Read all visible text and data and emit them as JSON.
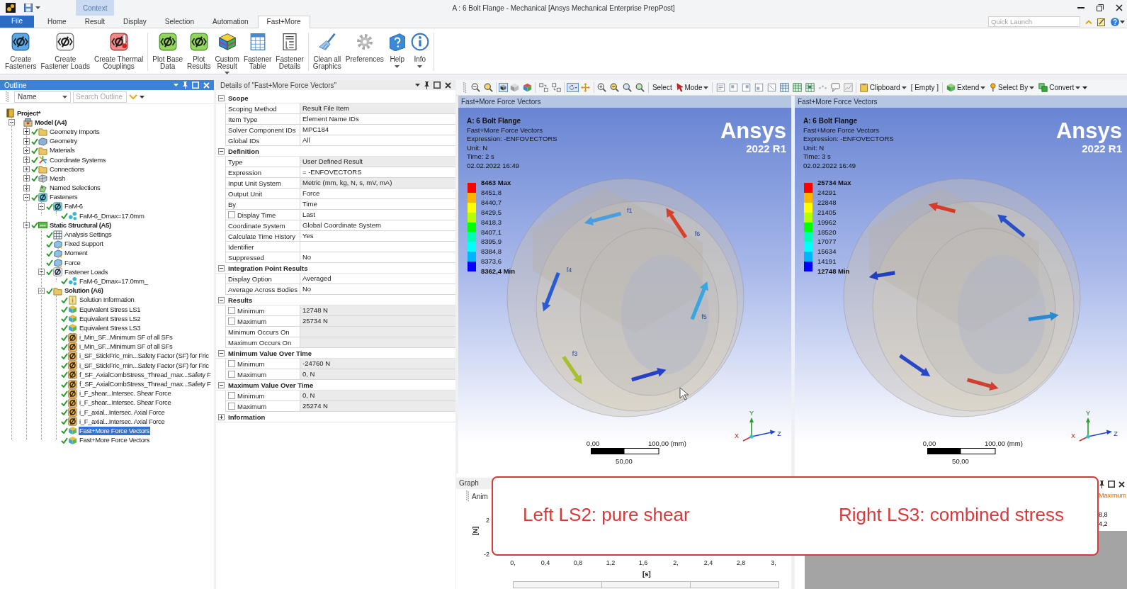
{
  "window": {
    "title": "A : 6 Bolt Flange - Mechanical [Ansys Mechanical Enterprise PrepPost]",
    "context_tab": "Context"
  },
  "tabs": [
    {
      "label": "File",
      "kind": "file",
      "selected": false
    },
    {
      "label": "Home",
      "kind": "tab",
      "selected": false
    },
    {
      "label": "Result",
      "kind": "tab",
      "selected": false
    },
    {
      "label": "Display",
      "kind": "tab",
      "selected": false
    },
    {
      "label": "Selection",
      "kind": "tab",
      "selected": false
    },
    {
      "label": "Automation",
      "kind": "tab",
      "selected": false
    },
    {
      "label": "Fast+More",
      "kind": "tab",
      "selected": true
    }
  ],
  "quick_launch": {
    "placeholder": "Quick Launch"
  },
  "ribbon": {
    "groups": [
      {
        "buttons": [
          {
            "label": "Create\nFasteners",
            "dropdown": false
          },
          {
            "label": "Create\nFastener Loads",
            "dropdown": false
          },
          {
            "label": "Create Thermal\nCouplings",
            "dropdown": false
          }
        ]
      },
      {
        "buttons": [
          {
            "label": "Plot Base\nData",
            "dropdown": false
          },
          {
            "label": "Plot\nResults",
            "dropdown": false
          },
          {
            "label": "Custom\nResult",
            "dropdown": true
          },
          {
            "label": "Fastener\nTable",
            "dropdown": false
          },
          {
            "label": "Fastener\nDetails",
            "dropdown": false
          }
        ]
      },
      {
        "buttons": [
          {
            "label": "Clean all\nGraphics",
            "dropdown": false
          },
          {
            "label": "Preferences",
            "dropdown": false
          },
          {
            "label": "Help",
            "dropdown": true
          },
          {
            "label": "Info",
            "dropdown": true
          }
        ]
      }
    ]
  },
  "outline": {
    "title": "Outline",
    "column": "Name",
    "search": {
      "placeholder": "Search Outline"
    },
    "tree": [
      {
        "label": "Project*",
        "kind": "project",
        "ok": false,
        "selected": false,
        "children": [
          {
            "label": "Model (A4)",
            "kind": "model",
            "ok": false,
            "selected": false,
            "expanded": true,
            "children": [
              {
                "label": "Geometry Imports",
                "kind": "folder",
                "ok": true,
                "selected": false,
                "expanded": false
              },
              {
                "label": "Geometry",
                "kind": "geometry",
                "ok": true,
                "selected": false,
                "expanded": false
              },
              {
                "label": "Materials",
                "kind": "folder",
                "ok": true,
                "selected": false,
                "expanded": false
              },
              {
                "label": "Coordinate Systems",
                "kind": "coordinates",
                "ok": true,
                "selected": false,
                "expanded": false
              },
              {
                "label": "Connections",
                "kind": "folder",
                "ok": true,
                "selected": false,
                "expanded": false
              },
              {
                "label": "Mesh",
                "kind": "mesh",
                "ok": true,
                "selected": false,
                "expanded": false
              },
              {
                "label": "Named Selections",
                "kind": "selection",
                "ok": false,
                "selected": false,
                "expanded": false
              },
              {
                "label": "Fasteners",
                "kind": "fastener",
                "ok": true,
                "selected": false,
                "expanded": true,
                "children": [
                  {
                    "label": "FaM-6",
                    "kind": "fastener",
                    "ok": true,
                    "selected": false,
                    "expanded": true,
                    "children": [
                      {
                        "label": "FaM-6_Dmax=17.0mm",
                        "kind": "points",
                        "ok": true,
                        "selected": false
                      }
                    ]
                  }
                ]
              },
              {
                "label": "Static Structural (A5)",
                "kind": "analysis",
                "ok": true,
                "selected": false,
                "expanded": true,
                "children": [
                  {
                    "label": "Analysis Settings",
                    "kind": "settings",
                    "ok": true,
                    "selected": false
                  },
                  {
                    "label": "Fixed Support",
                    "kind": "load",
                    "ok": true,
                    "selected": false
                  },
                  {
                    "label": "Moment",
                    "kind": "load",
                    "ok": true,
                    "selected": false
                  },
                  {
                    "label": "Force",
                    "kind": "load",
                    "ok": true,
                    "selected": false
                  },
                  {
                    "label": "Fastener Loads",
                    "kind": "fastener-load",
                    "ok": true,
                    "selected": false,
                    "expanded": true,
                    "children": [
                      {
                        "label": "FaM-6_Dmax=17.0mm_",
                        "kind": "points",
                        "ok": true,
                        "selected": false
                      }
                    ]
                  },
                  {
                    "label": "Solution (A6)",
                    "kind": "solution",
                    "ok": true,
                    "selected": false,
                    "expanded": true,
                    "children": [
                      {
                        "label": "Solution Information",
                        "kind": "info",
                        "ok": true,
                        "selected": false
                      },
                      {
                        "label": "Equivalent Stress LS1",
                        "kind": "result",
                        "ok": true,
                        "selected": false
                      },
                      {
                        "label": "Equivalent Stress LS2",
                        "kind": "result",
                        "ok": true,
                        "selected": false
                      },
                      {
                        "label": "Equivalent Stress LS3",
                        "kind": "result",
                        "ok": true,
                        "selected": false
                      },
                      {
                        "label": "i_Min_SF...Minimum SF of all SFs",
                        "kind": "sf-result",
                        "ok": true,
                        "selected": false
                      },
                      {
                        "label": "i_Min_SF...Minimum SF of all SFs",
                        "kind": "sf-result",
                        "ok": true,
                        "selected": false
                      },
                      {
                        "label": "i_SF_StickFric_min...Safety Factor (SF) for Fric",
                        "kind": "sf-result",
                        "ok": true,
                        "selected": false
                      },
                      {
                        "label": "i_SF_StickFric_min...Safety Factor (SF) for Fric",
                        "kind": "sf-result",
                        "ok": true,
                        "selected": false
                      },
                      {
                        "label": "f_SF_AxialCombStress_Thread_max...Safety F",
                        "kind": "sf-result",
                        "ok": true,
                        "selected": false
                      },
                      {
                        "label": "f_SF_AxialCombStress_Thread_max...Safety F",
                        "kind": "sf-result",
                        "ok": true,
                        "selected": false
                      },
                      {
                        "label": "i_F_shear...Intersec. Shear Force",
                        "kind": "sf-result",
                        "ok": true,
                        "selected": false
                      },
                      {
                        "label": "i_F_shear...Intersec. Shear Force",
                        "kind": "sf-result",
                        "ok": true,
                        "selected": false
                      },
                      {
                        "label": "i_F_axial...Intersec. Axial Force",
                        "kind": "sf-result",
                        "ok": true,
                        "selected": false
                      },
                      {
                        "label": "i_F_axial...Intersec. Axial Force",
                        "kind": "sf-result",
                        "ok": true,
                        "selected": false
                      },
                      {
                        "label": "Fast+More Force Vectors",
                        "kind": "user-result",
                        "ok": true,
                        "selected": true
                      },
                      {
                        "label": "Fast+More Force Vectors",
                        "kind": "user-result",
                        "ok": true,
                        "selected": false
                      }
                    ]
                  }
                ]
              }
            ]
          }
        ]
      }
    ]
  },
  "details": {
    "title": "Details of \"Fast+More Force Vectors\"",
    "groups": [
      {
        "title": "Scope",
        "expanded": true,
        "rows": [
          {
            "label": "Scoping Method",
            "value": "Result File Item",
            "kind": "plain",
            "readonly": true
          },
          {
            "label": "Item Type",
            "value": "Element Name IDs",
            "kind": "plain",
            "readonly": false
          },
          {
            "label": "Solver Component IDs",
            "value": "MPC184",
            "kind": "plain",
            "readonly": false
          },
          {
            "label": "Global IDs",
            "value": "All",
            "kind": "plain",
            "readonly": false
          }
        ]
      },
      {
        "title": "Definition",
        "expanded": true,
        "rows": [
          {
            "label": "Type",
            "value": "User Defined Result",
            "kind": "plain",
            "readonly": true
          },
          {
            "label": "Expression",
            "value": "= -ENFOVECTORS",
            "kind": "plain",
            "readonly": false
          },
          {
            "label": "Input Unit System",
            "value": "Metric (mm, kg, N, s, mV, mA)",
            "kind": "plain",
            "readonly": true
          },
          {
            "label": "Output Unit",
            "value": "Force",
            "kind": "plain",
            "readonly": false
          },
          {
            "label": "By",
            "value": "Time",
            "kind": "plain",
            "readonly": false
          },
          {
            "label": "Display Time",
            "value": "Last",
            "kind": "check",
            "checked": false,
            "readonly": false
          },
          {
            "label": "Coordinate System",
            "value": "Global Coordinate System",
            "kind": "plain",
            "readonly": false
          },
          {
            "label": "Calculate Time History",
            "value": "Yes",
            "kind": "plain",
            "readonly": false
          },
          {
            "label": "Identifier",
            "kind": "plain",
            "readonly": false
          },
          {
            "label": "Suppressed",
            "value": "No",
            "kind": "plain",
            "readonly": false
          }
        ]
      },
      {
        "title": "Integration Point Results",
        "expanded": true,
        "rows": [
          {
            "label": "Display Option",
            "value": "Averaged",
            "kind": "plain",
            "readonly": false
          },
          {
            "label": "Average Across Bodies",
            "value": "No",
            "kind": "plain",
            "readonly": false
          }
        ]
      },
      {
        "title": "Results",
        "expanded": true,
        "rows": [
          {
            "label": "Minimum",
            "value": "12748 N",
            "kind": "check",
            "checked": false,
            "readonly": true
          },
          {
            "label": "Maximum",
            "value": "25734 N",
            "kind": "check",
            "checked": false,
            "readonly": true
          },
          {
            "label": "Minimum Occurs On",
            "kind": "plain",
            "readonly": true
          },
          {
            "label": "Maximum Occurs On",
            "kind": "plain",
            "readonly": true
          }
        ]
      },
      {
        "title": "Minimum Value Over Time",
        "expanded": true,
        "rows": [
          {
            "label": "Minimum",
            "value": "-24760 N",
            "kind": "check",
            "checked": false,
            "readonly": true
          },
          {
            "label": "Maximum",
            "value": "0, N",
            "kind": "check",
            "checked": false,
            "readonly": true
          }
        ]
      },
      {
        "title": "Maximum Value Over Time",
        "expanded": true,
        "rows": [
          {
            "label": "Minimum",
            "value": "0, N",
            "kind": "check",
            "checked": false,
            "readonly": true
          },
          {
            "label": "Maximum",
            "value": "25274 N",
            "kind": "check",
            "checked": false,
            "readonly": true
          }
        ]
      },
      {
        "title": "Information",
        "expanded": false
      }
    ]
  },
  "view_toolbar": {
    "tools": [
      {
        "selected": false
      },
      {
        "selected": false
      },
      {
        "selected": true
      },
      {
        "selected": false
      },
      {
        "selected": false
      },
      {
        "selected": false
      },
      {
        "selected": false
      },
      {
        "selected": true
      },
      {
        "selected": false
      },
      {
        "selected": false
      },
      {
        "selected": false
      },
      {
        "selected": false
      },
      {
        "selected": false
      },
      {
        "selected": false
      },
      {
        "selected": false
      },
      {
        "selected": false
      },
      {
        "selected": false
      },
      {
        "selected": false
      },
      {
        "selected": false
      },
      {
        "selected": false
      },
      {
        "selected": false
      },
      {
        "selected": false
      },
      {
        "selected": false
      },
      {
        "selected": false
      }
    ],
    "buttons": [
      {
        "label": "Select",
        "dropdown": false
      },
      {
        "label": "Mode",
        "dropdown": true
      },
      {
        "label": "Clipboard",
        "dropdown": true
      },
      {
        "label": "[ Empty ]",
        "dropdown": false
      },
      {
        "label": "Extend",
        "dropdown": true
      },
      {
        "label": "Select By",
        "dropdown": true
      },
      {
        "label": "Convert",
        "dropdown": true
      }
    ]
  },
  "viewports": [
    {
      "header": "Fast+More Force Vectors",
      "info": {
        "title": "A: 6 Bolt Flange",
        "lines": [
          "Fast+More Force Vectors",
          "Expression: -ENFOVECTORS",
          "Unit: N",
          "Time: 2 s",
          "02.02.2022 16:49"
        ]
      },
      "logo": {
        "name": "Ansys",
        "version": "2022 R1"
      },
      "legend": {
        "labels": [
          "8463 Max",
          "8451,8",
          "8440,7",
          "8429,5",
          "8418,3",
          "8407,1",
          "8395,9",
          "8384,8",
          "8373,6",
          "8362,4 Min"
        ],
        "bands": [
          {
            "color": "#ff0000"
          },
          {
            "color": "#ffb400"
          },
          {
            "color": "#ffff00"
          },
          {
            "color": "#b4ff00"
          },
          {
            "color": "#00ff00"
          },
          {
            "color": "#00ffb4"
          },
          {
            "color": "#00ffff"
          },
          {
            "color": "#00b4ff"
          },
          {
            "color": "#0000ff"
          }
        ]
      },
      "vectors": [
        {
          "label": "f1",
          "color": "#4a9ee0"
        },
        {
          "label": "f6",
          "color": "#d8402a"
        },
        {
          "label": "f4",
          "color": "#2a5bd0"
        },
        {
          "label": "f5",
          "color": "#3aa6e0"
        },
        {
          "label": "f3",
          "color": "#a8c030"
        },
        {
          "color": "#2840c8"
        }
      ],
      "mouse_pointer": true,
      "triad": {
        "x": "X",
        "y": "Y",
        "z": "Z"
      },
      "scale": {
        "start": "0,00",
        "end": "100,00 (mm)",
        "middle": "50,00"
      }
    },
    {
      "header": "Fast+More Force Vectors",
      "info": {
        "title": "A: 6 Bolt Flange",
        "lines": [
          "Fast+More Force Vectors",
          "Expression: -ENFOVECTORS",
          "Unit: N",
          "Time: 3 s",
          "02.02.2022 16:49"
        ]
      },
      "logo": {
        "name": "Ansys",
        "version": "2022 R1"
      },
      "legend": {
        "labels": [
          "25734 Max",
          "24291",
          "22848",
          "21405",
          "19962",
          "18520",
          "17077",
          "15634",
          "14191",
          "12748 Min"
        ],
        "bands": [
          {
            "color": "#ff0000"
          },
          {
            "color": "#ffb400"
          },
          {
            "color": "#ffff00"
          },
          {
            "color": "#b4ff00"
          },
          {
            "color": "#00ff00"
          },
          {
            "color": "#00ffb4"
          },
          {
            "color": "#00ffff"
          },
          {
            "color": "#00b4ff"
          },
          {
            "color": "#0000ff"
          }
        ]
      },
      "vectors": [
        {
          "color": "#d83a2a"
        },
        {
          "color": "#2a50c8"
        },
        {
          "color": "#2040c0"
        },
        {
          "color": "#2a8ad0"
        },
        {
          "color": "#2848c8"
        },
        {
          "color": "#d04030"
        }
      ],
      "triad": {
        "x": "X",
        "y": "Y",
        "z": "Z"
      },
      "scale": {
        "start": "0,00",
        "end": "100,00 (mm)",
        "middle": "50,00"
      }
    }
  ],
  "graph": {
    "title": "Graph",
    "toolbar_label": "Anim",
    "y_label": "[N]",
    "y_ticks": [
      "2",
      "-2"
    ],
    "x_ticks": [
      "0,",
      "0,4",
      "0,8",
      "1,2",
      "1,6",
      "2,",
      "2,4",
      "2,8",
      "3,"
    ],
    "x_label": "[s]"
  },
  "side_panel": {
    "column": "Maximum",
    "values": [
      "8,8",
      "4,2"
    ]
  },
  "callout": {
    "texts": [
      "Left LS2: pure shear",
      "Right LS3: combined stress"
    ]
  }
}
